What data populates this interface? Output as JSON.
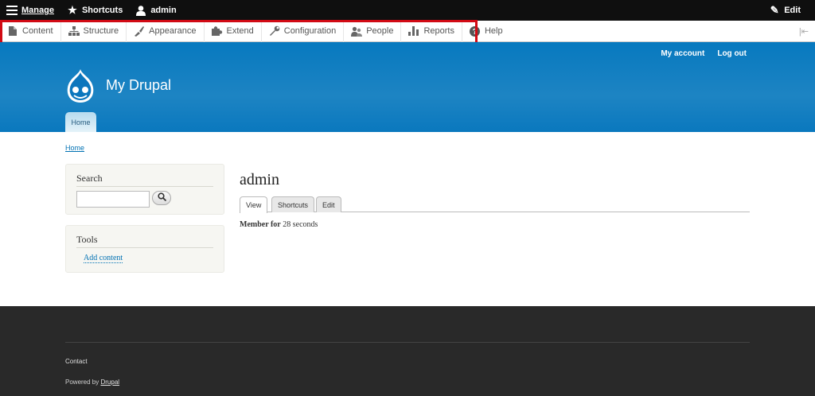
{
  "toolbar": {
    "manage_label": "Manage",
    "shortcuts_label": "Shortcuts",
    "user_label": "admin",
    "edit_label": "Edit",
    "menu_icon": "hamburger-icon",
    "star_icon": "star-icon",
    "user_icon": "person-icon",
    "pencil_icon": "pencil-icon"
  },
  "tray": {
    "items": [
      {
        "label": "Content",
        "icon": "document-icon"
      },
      {
        "label": "Structure",
        "icon": "sitemap-icon"
      },
      {
        "label": "Appearance",
        "icon": "paintbrush-icon"
      },
      {
        "label": "Extend",
        "icon": "puzzle-icon"
      },
      {
        "label": "Configuration",
        "icon": "wrench-icon"
      },
      {
        "label": "People",
        "icon": "people-icon"
      },
      {
        "label": "Reports",
        "icon": "bar-chart-icon"
      },
      {
        "label": "Help",
        "icon": "question-icon"
      }
    ],
    "highlight_color": "#d10a14"
  },
  "header": {
    "site_name": "My Drupal",
    "secondary_menu": [
      "My account",
      "Log out"
    ],
    "primary_tab": "Home",
    "colors": {
      "header_blue": "#0779bf"
    }
  },
  "breadcrumb": "Home",
  "sidebar": {
    "search": {
      "title": "Search",
      "value": "",
      "placeholder": ""
    },
    "tools": {
      "title": "Tools",
      "link": "Add content"
    }
  },
  "main": {
    "title": "admin",
    "tabs": [
      "View",
      "Shortcuts",
      "Edit"
    ],
    "active_tab": "View",
    "member_for_label": "Member for",
    "member_for_value": "28 seconds"
  },
  "footer": {
    "contact": "Contact",
    "powered_prefix": "Powered by",
    "powered_link": "Drupal"
  }
}
